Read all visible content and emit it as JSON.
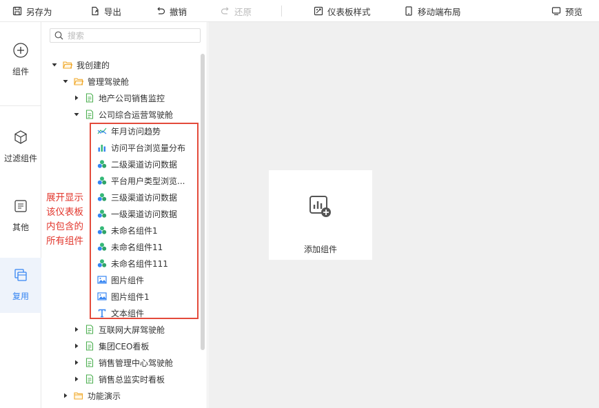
{
  "toolbar": {
    "save_as": "另存为",
    "export": "导出",
    "undo": "撤销",
    "redo": "还原",
    "dashboard_style": "仪表板样式",
    "mobile_layout": "移动端布局",
    "preview": "预览"
  },
  "rail": {
    "items": [
      {
        "label": "组件"
      },
      {
        "label": "过滤组件"
      },
      {
        "label": "其他"
      },
      {
        "label": "复用"
      }
    ],
    "active_color": "#3685f2"
  },
  "search": {
    "placeholder": "搜索"
  },
  "tree": {
    "my_created": "我创建的",
    "mgmt_cockpit": "管理驾驶舱",
    "realestate_monitor": "地产公司销售监控",
    "company_ops": "公司综合运营驾驶舱",
    "components": [
      {
        "label": "年月访问趋势",
        "icon": "line-chart-icon"
      },
      {
        "label": "访问平台浏览量分布",
        "icon": "bar-chart-icon"
      },
      {
        "label": "二级渠道访问数据",
        "icon": "multi-chart-icon"
      },
      {
        "label": "平台用户类型浏览...",
        "icon": "multi-chart-icon"
      },
      {
        "label": "三级渠道访问数据",
        "icon": "multi-chart-icon"
      },
      {
        "label": "一级渠道访问数据",
        "icon": "multi-chart-icon"
      },
      {
        "label": "未命名组件1",
        "icon": "multi-chart-icon"
      },
      {
        "label": "未命名组件11",
        "icon": "multi-chart-icon"
      },
      {
        "label": "未命名组件111",
        "icon": "multi-chart-icon"
      },
      {
        "label": "图片组件",
        "icon": "image-icon"
      },
      {
        "label": "图片组件1",
        "icon": "image-icon"
      },
      {
        "label": "文本组件",
        "icon": "text-icon"
      }
    ],
    "internet_screen": "互联网大屏驾驶舱",
    "group_ceo": "集团CEO看板",
    "sales_center": "销售管理中心驾驶舱",
    "sales_director": "销售总监实时看板",
    "feature_demo": "功能演示"
  },
  "annotation": {
    "text": "展开显示该仪表板内包含的所有组件",
    "color": "#e2362c"
  },
  "canvas": {
    "add_component": "添加组件"
  },
  "colors": {
    "folder": "#f0a92e",
    "dashboard": "#4caf50",
    "chart_blue": "#3685f2",
    "chart_green": "#35b878"
  }
}
